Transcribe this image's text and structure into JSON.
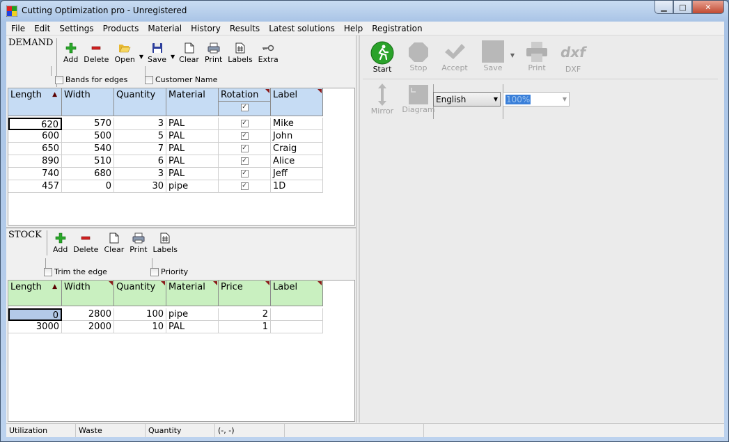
{
  "window": {
    "title": "Cutting Optimization pro - Unregistered",
    "min": "▁",
    "max": "□",
    "close": "✕"
  },
  "menu": [
    "File",
    "Edit",
    "Settings",
    "Products",
    "Material",
    "History",
    "Results",
    "Latest solutions",
    "Help",
    "Registration"
  ],
  "demand": {
    "title": "DEMAND",
    "toolbar": {
      "add": "Add",
      "delete": "Delete",
      "open": "Open",
      "save": "Save",
      "clear": "Clear",
      "print": "Print",
      "labels": "Labels",
      "extra": "Extra"
    },
    "bands_for_edges": "Bands for edges",
    "customer_name": "Customer Name",
    "columns": [
      "Length",
      "Width",
      "Quantity",
      "Material",
      "Rotation",
      "Label"
    ],
    "rows": [
      [
        "620",
        "570",
        "3",
        "PAL",
        "✓",
        "Mike"
      ],
      [
        "600",
        "500",
        "5",
        "PAL",
        "✓",
        "John"
      ],
      [
        "650",
        "540",
        "7",
        "PAL",
        "✓",
        "Craig"
      ],
      [
        "890",
        "510",
        "6",
        "PAL",
        "✓",
        "Alice"
      ],
      [
        "740",
        "680",
        "3",
        "PAL",
        "✓",
        "Jeff"
      ],
      [
        "457",
        "0",
        "30",
        "pipe",
        "✓",
        "1D"
      ]
    ],
    "header_color": "#c6dcf4"
  },
  "stock": {
    "title": "STOCK",
    "toolbar": {
      "add": "Add",
      "delete": "Delete",
      "clear": "Clear",
      "print": "Print",
      "labels": "Labels"
    },
    "trim_the_edge": "Trim the edge",
    "priority": "Priority",
    "columns": [
      "Length",
      "Width",
      "Quantity",
      "Material",
      "Price",
      "Label"
    ],
    "rows": [
      [
        "0",
        "2800",
        "100",
        "pipe",
        "2",
        ""
      ],
      [
        "3000",
        "2000",
        "10",
        "PAL",
        "1",
        ""
      ]
    ],
    "header_color": "#c9f0c0"
  },
  "right_toolbar": {
    "start": "Start",
    "stop": "Stop",
    "accept": "Accept",
    "save": "Save",
    "print": "Print",
    "dxf": "DXF",
    "dxf_logo": "dxf",
    "mirror": "Mirror",
    "diagram": "Diagram"
  },
  "language": "English",
  "zoom": "100%",
  "statusbar": [
    "Utilization",
    "Waste",
    "Quantity",
    "(-, -)"
  ]
}
